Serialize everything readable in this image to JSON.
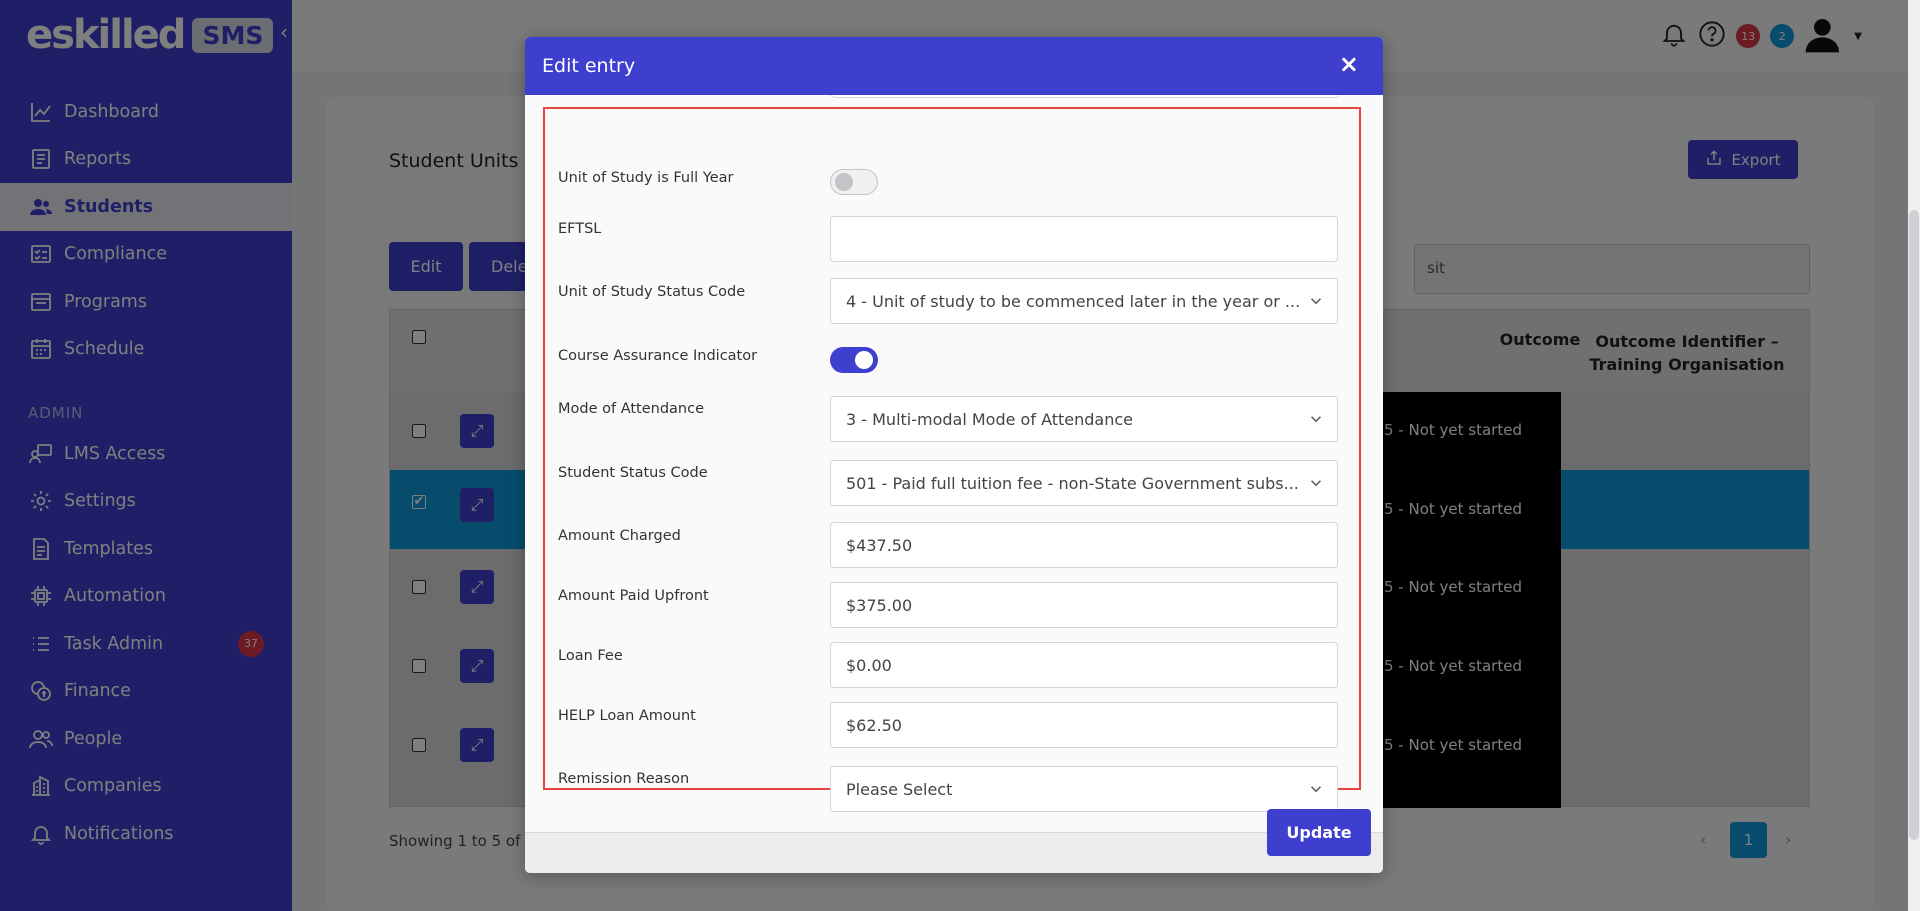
{
  "brand": {
    "name": "eskilled",
    "badge": "SMS"
  },
  "sidebar": {
    "items": [
      {
        "label": "Dashboard",
        "icon": "chart-line-icon"
      },
      {
        "label": "Reports",
        "icon": "report-icon"
      },
      {
        "label": "Students",
        "icon": "users-icon"
      },
      {
        "label": "Compliance",
        "icon": "checklist-icon"
      },
      {
        "label": "Programs",
        "icon": "window-icon"
      },
      {
        "label": "Schedule",
        "icon": "calendar-icon"
      }
    ],
    "admin_label": "ADMIN",
    "admin_items": [
      {
        "label": "LMS Access",
        "icon": "user-screen-icon"
      },
      {
        "label": "Settings",
        "icon": "gear-icon"
      },
      {
        "label": "Templates",
        "icon": "document-icon"
      },
      {
        "label": "Automation",
        "icon": "chip-icon"
      },
      {
        "label": "Task Admin",
        "icon": "list-icon",
        "badge": "37"
      },
      {
        "label": "Finance",
        "icon": "coins-icon"
      },
      {
        "label": "People",
        "icon": "people-icon"
      },
      {
        "label": "Companies",
        "icon": "building-icon"
      },
      {
        "label": "Notifications",
        "icon": "bell-icon"
      }
    ]
  },
  "topbar": {
    "badge_red": "13",
    "badge_blue": "2"
  },
  "page": {
    "title": "Student Units",
    "export_label": "Export",
    "edit_label": "Edit",
    "delete_label": "Dele",
    "search_value": "sit",
    "table_headers": {
      "outcome": "Outcome",
      "outcome_identifier": "Outcome Identifier – Training Organisation"
    },
    "rows": [
      {
        "outcome": "5 - Not yet started",
        "selected": false
      },
      {
        "outcome": "5 - Not yet started",
        "selected": true
      },
      {
        "outcome": "5 - Not yet started",
        "selected": false
      },
      {
        "outcome": "5 - Not yet started",
        "selected": false
      },
      {
        "outcome": "5 - Not yet started",
        "selected": false
      }
    ],
    "showing": "Showing 1 to 5 of 5",
    "current_page": "1"
  },
  "modal": {
    "title": "Edit entry",
    "close": "×",
    "fields": {
      "full_year": {
        "label": "Unit of Study is Full Year",
        "on": false
      },
      "eftsl": {
        "label": "EFTSL",
        "value": ""
      },
      "status_code": {
        "label": "Unit of Study Status Code",
        "value": "4 - Unit of study to be commenced later in the year or ..."
      },
      "assurance": {
        "label": "Course Assurance Indicator",
        "on": true
      },
      "attendance": {
        "label": "Mode of Attendance",
        "value": "3 - Multi-modal Mode of Attendance"
      },
      "student_status": {
        "label": "Student Status Code",
        "value": "501 - Paid full tuition fee - non-State Government subs..."
      },
      "amount_charged": {
        "label": "Amount Charged",
        "value": "$437.50"
      },
      "amount_paid": {
        "label": "Amount Paid Upfront",
        "value": "$375.00"
      },
      "loan_fee": {
        "label": "Loan Fee",
        "value": "$0.00"
      },
      "help_loan": {
        "label": "HELP Loan Amount",
        "value": "$62.50"
      },
      "remission": {
        "label": "Remission Reason",
        "value": "Please Select"
      }
    },
    "update_label": "Update"
  },
  "colors": {
    "primary": "#3f3fcf",
    "selected_row": "#0e99d9",
    "highlight": "#e6453f",
    "danger": "#d9364a"
  }
}
